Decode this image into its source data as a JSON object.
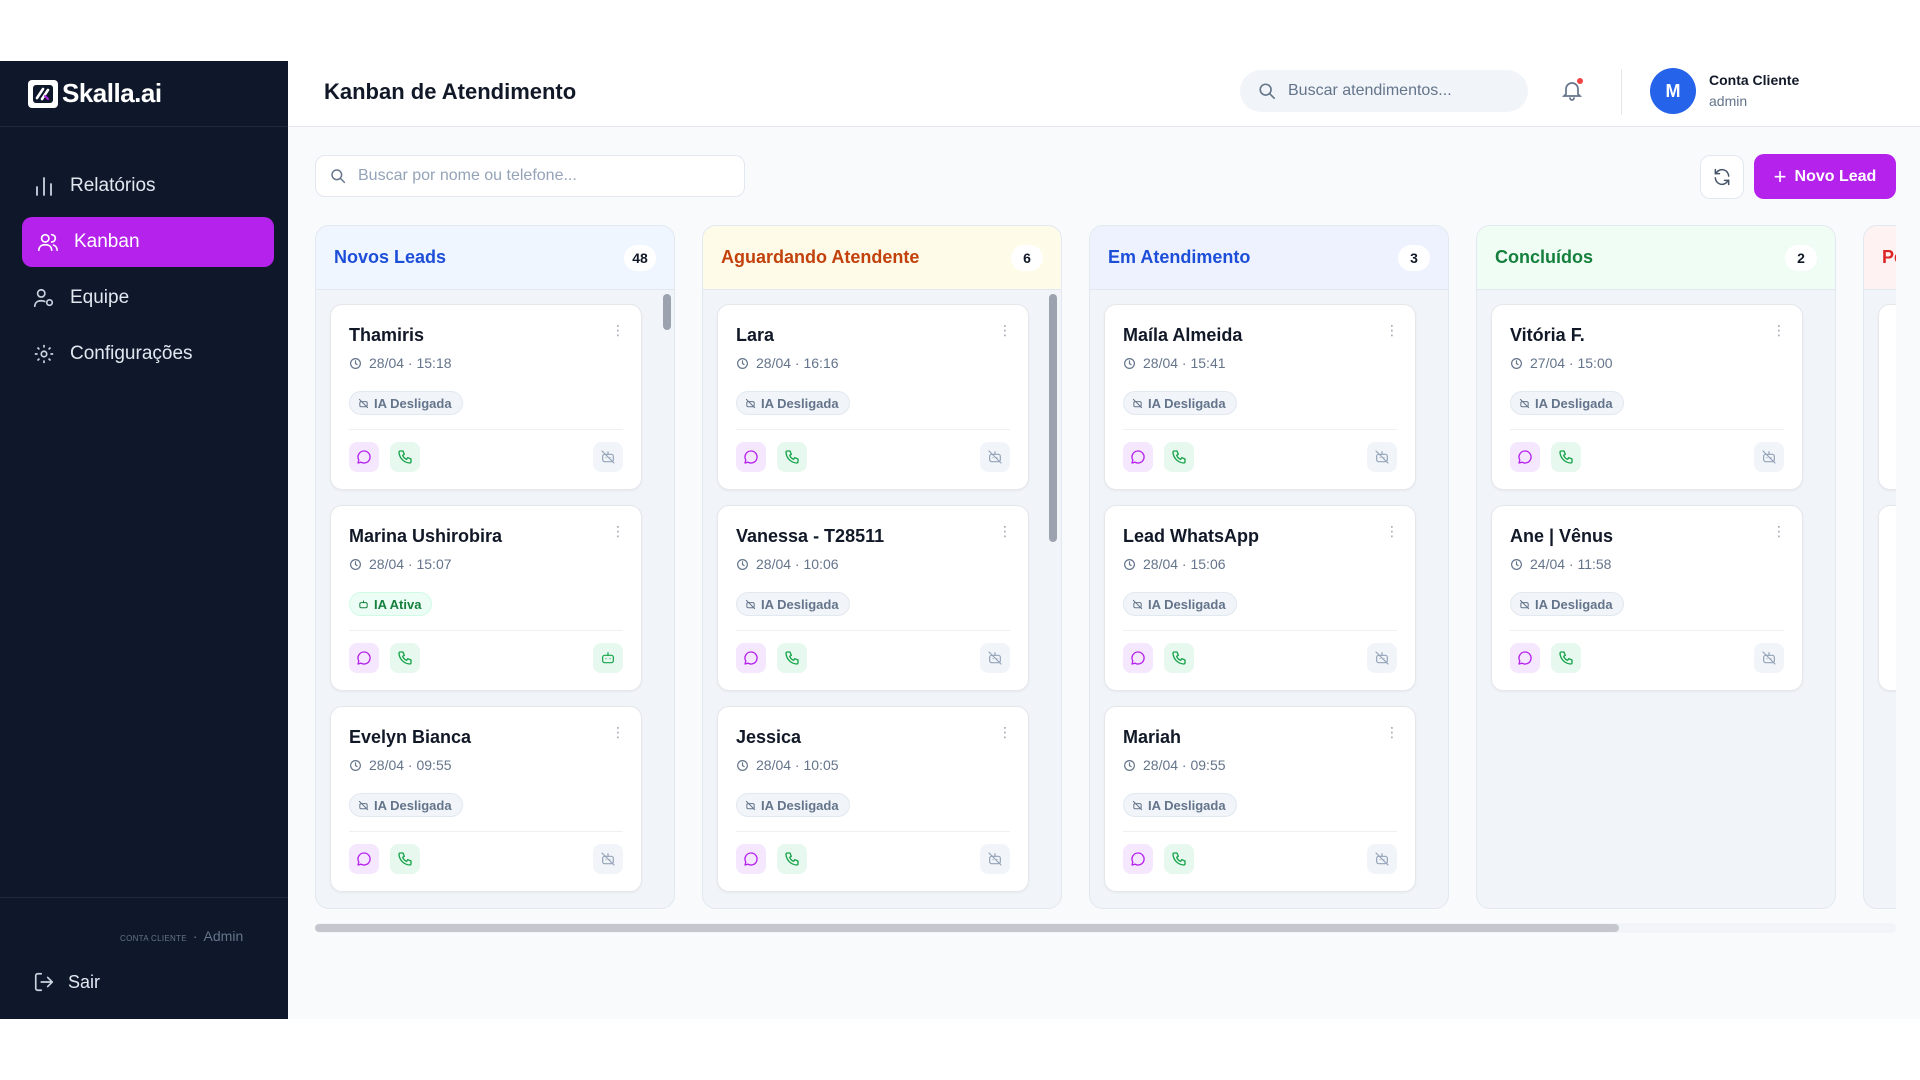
{
  "brand": {
    "name": "Skalla.ai"
  },
  "sidebar": {
    "items": [
      {
        "label": "Relatórios",
        "icon": "bar-chart-icon"
      },
      {
        "label": "Kanban",
        "icon": "users-icon",
        "active": true
      },
      {
        "label": "Equipe",
        "icon": "user-gear-icon"
      },
      {
        "label": "Configurações",
        "icon": "settings-icon"
      }
    ],
    "account_small": "CONTA CLIENTE",
    "account_dot": "·",
    "account_role": "Admin",
    "logout_label": "Sair"
  },
  "header": {
    "title": "Kanban de Atendimento",
    "search_placeholder": "Buscar atendimentos...",
    "user_initial": "M",
    "user_name": "Conta Cliente",
    "user_role": "admin"
  },
  "toolbar": {
    "search_placeholder": "Buscar por nome ou telefone...",
    "new_lead_label": "Novo Lead"
  },
  "colors": {
    "accent": "#b522ec",
    "sidebar_bg": "#0f172a"
  },
  "columns": [
    {
      "title": "Novos Leads",
      "count": "48",
      "color": "#1d4ed8",
      "bg": "#eff6ff",
      "cards": [
        {
          "name": "Thamiris",
          "time": "28/04 · 15:18",
          "badge": "IA Desligada",
          "ai_on": false
        },
        {
          "name": "Marina Ushirobira",
          "time": "28/04 · 15:07",
          "badge": "IA Ativa",
          "ai_on": true
        },
        {
          "name": "Evelyn Bianca",
          "time": "28/04 · 09:55",
          "badge": "IA Desligada",
          "ai_on": false
        }
      ]
    },
    {
      "title": "Aguardando Atendente",
      "count": "6",
      "color": "#c2410c",
      "bg": "#fefce8",
      "cards": [
        {
          "name": "Lara",
          "time": "28/04 · 16:16",
          "badge": "IA Desligada",
          "ai_on": false
        },
        {
          "name": "Vanessa - T28511",
          "time": "28/04 · 10:06",
          "badge": "IA Desligada",
          "ai_on": false
        },
        {
          "name": "Jessica",
          "time": "28/04 · 10:05",
          "badge": "IA Desligada",
          "ai_on": false
        }
      ]
    },
    {
      "title": "Em Atendimento",
      "count": "3",
      "color": "#1d4ed8",
      "bg": "#eef2ff",
      "cards": [
        {
          "name": "Maíla Almeida",
          "time": "28/04 · 15:41",
          "badge": "IA Desligada",
          "ai_on": false
        },
        {
          "name": "Lead WhatsApp",
          "time": "28/04 · 15:06",
          "badge": "IA Desligada",
          "ai_on": false
        },
        {
          "name": "Mariah",
          "time": "28/04 · 09:55",
          "badge": "IA Desligada",
          "ai_on": false
        }
      ]
    },
    {
      "title": "Concluídos",
      "count": "2",
      "color": "#15803d",
      "bg": "#f0fdf4",
      "cards": [
        {
          "name": "Vitória F.",
          "time": "27/04 · 15:00",
          "badge": "IA Desligada",
          "ai_on": false
        },
        {
          "name": "Ane | Vênus",
          "time": "24/04 · 11:58",
          "badge": "IA Desligada",
          "ai_on": false
        }
      ]
    },
    {
      "title": "Pe",
      "count": "",
      "color": "#dc2626",
      "bg": "#fef2f2",
      "cards": [
        {
          "name": "",
          "time": "",
          "badge": "",
          "ai_on": false
        },
        {
          "name": "",
          "time": "",
          "badge": "",
          "ai_on": false
        }
      ]
    }
  ]
}
